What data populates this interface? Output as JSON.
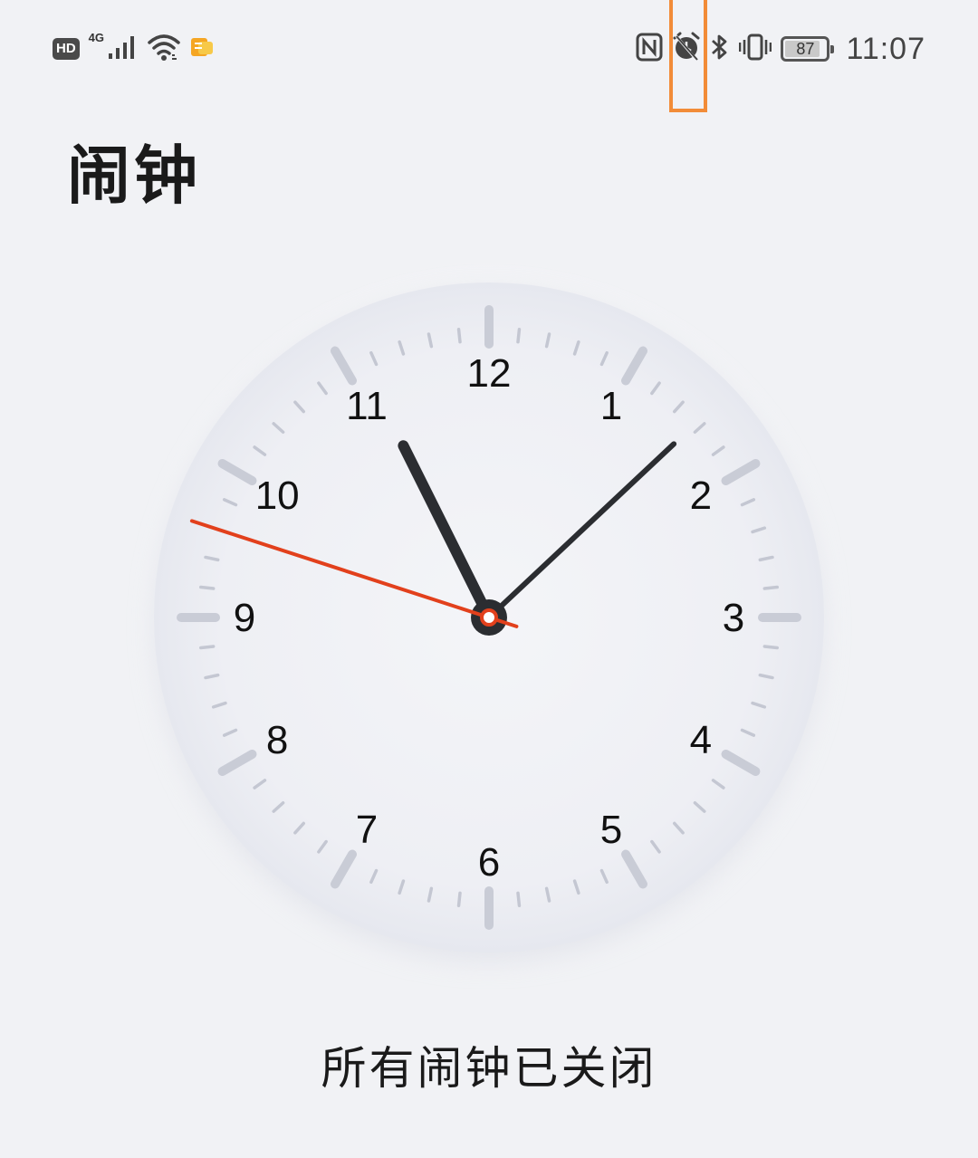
{
  "status_bar": {
    "left": {
      "hd_label": "HD",
      "network_type": "4G",
      "icons": [
        "signal-icon",
        "wifi-icon",
        "app-notification-icon"
      ]
    },
    "right": {
      "icons": [
        "nfc-icon",
        "alarm-off-icon",
        "bluetooth-icon",
        "vibrate-icon"
      ],
      "battery_percent": "87",
      "battery_level": 0.87,
      "time": "11:07"
    }
  },
  "page": {
    "title": "闹钟"
  },
  "clock": {
    "numerals": [
      "12",
      "1",
      "2",
      "3",
      "4",
      "5",
      "6",
      "7",
      "8",
      "9",
      "10",
      "11"
    ],
    "time_shown": {
      "hour": 11,
      "minute": 7,
      "second": 48
    },
    "colors": {
      "hands": "#2b2d31",
      "second_hand": "#e2401c",
      "ticks_major": "#c9ccd6",
      "ticks_minor": "#c4c7d2"
    }
  },
  "alarm_status": "所有闹钟已关闭"
}
